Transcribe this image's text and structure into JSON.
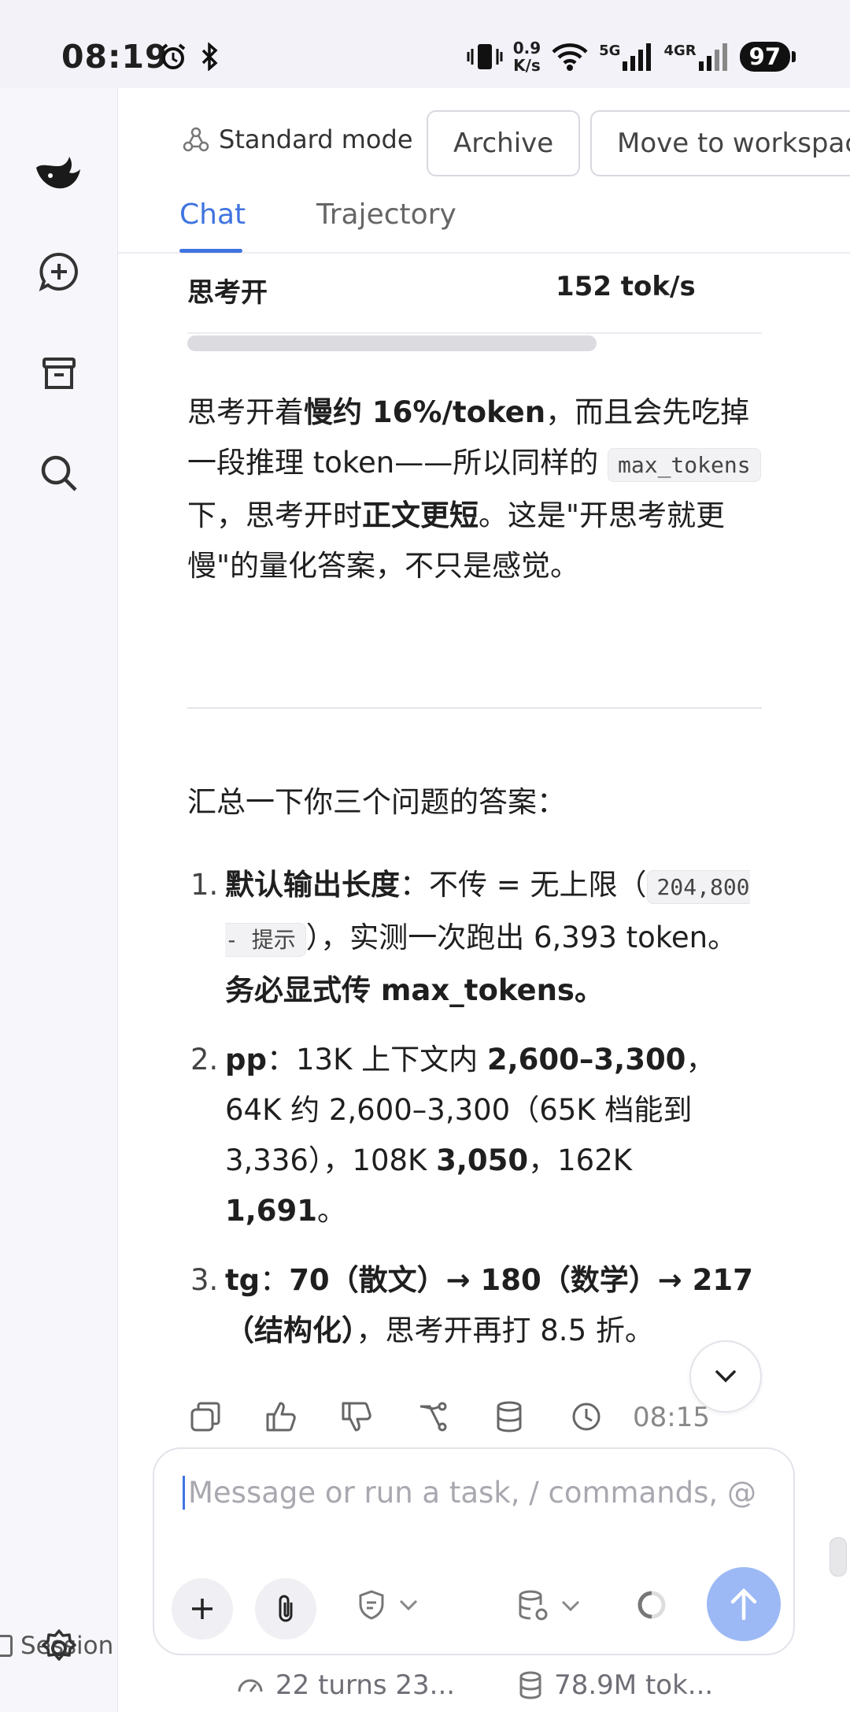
{
  "status": {
    "time": "08:19",
    "net_speed_top": "0.9",
    "net_speed_bottom": "K/s",
    "signal1": "5G",
    "signal2": "4GR",
    "battery": "97"
  },
  "sidebar": {
    "session_label": "Session"
  },
  "header": {
    "mode_label": "Standard mode",
    "archive_label": "Archive",
    "move_label": "Move to workspac",
    "tabs": [
      {
        "label": "Chat"
      },
      {
        "label": "Trajectory"
      }
    ]
  },
  "message": {
    "table_row": {
      "col1": "思考开",
      "col2": "152 tok/s"
    },
    "para": {
      "p1a": "思考开着",
      "p1b": "慢约 16%/token",
      "p1c": "，而且会先吃掉一段推理 token——所以同样的 ",
      "code": "max_tokens",
      "p1d": " 下，思考开时",
      "p1e": "正文更短",
      "p1f": "。这是\"开思考就更慢\"的量化答案，不只是感觉。"
    },
    "summary": "汇总一下你三个问题的答案：",
    "list": [
      {
        "num": "1.",
        "a": "默认输出长度",
        "b": "：不传 = 无上限（",
        "code": "204,800 - 提示",
        "c": "），实测一次跑出 6,393 token。",
        "d": "务必显式传 max_tokens。"
      },
      {
        "num": "2.",
        "a": "pp",
        "b": "：13K 上下文内 ",
        "c": "2,600–3,300",
        "d": "，64K 约 2,600–3,300（65K 档能到 3,336），108K ",
        "e": "3,050",
        "f": "，162K ",
        "g": "1,691",
        "h": "。"
      },
      {
        "num": "3.",
        "a": "tg",
        "b": "：",
        "c": "70（散文）→ 180（数学）→ 217（结构化）",
        "d": "，思考开再打 8.5 折。"
      }
    ],
    "time": "08:15"
  },
  "composer": {
    "placeholder": "Message or run a task, / commands, @ fi..."
  },
  "footer": {
    "turns": "22 turns 23...",
    "tokens": "78.9M tok..."
  },
  "colors": {
    "accent": "#3f74e0",
    "send": "#9db9f5",
    "sidebar_bg": "#f6f6fb"
  }
}
